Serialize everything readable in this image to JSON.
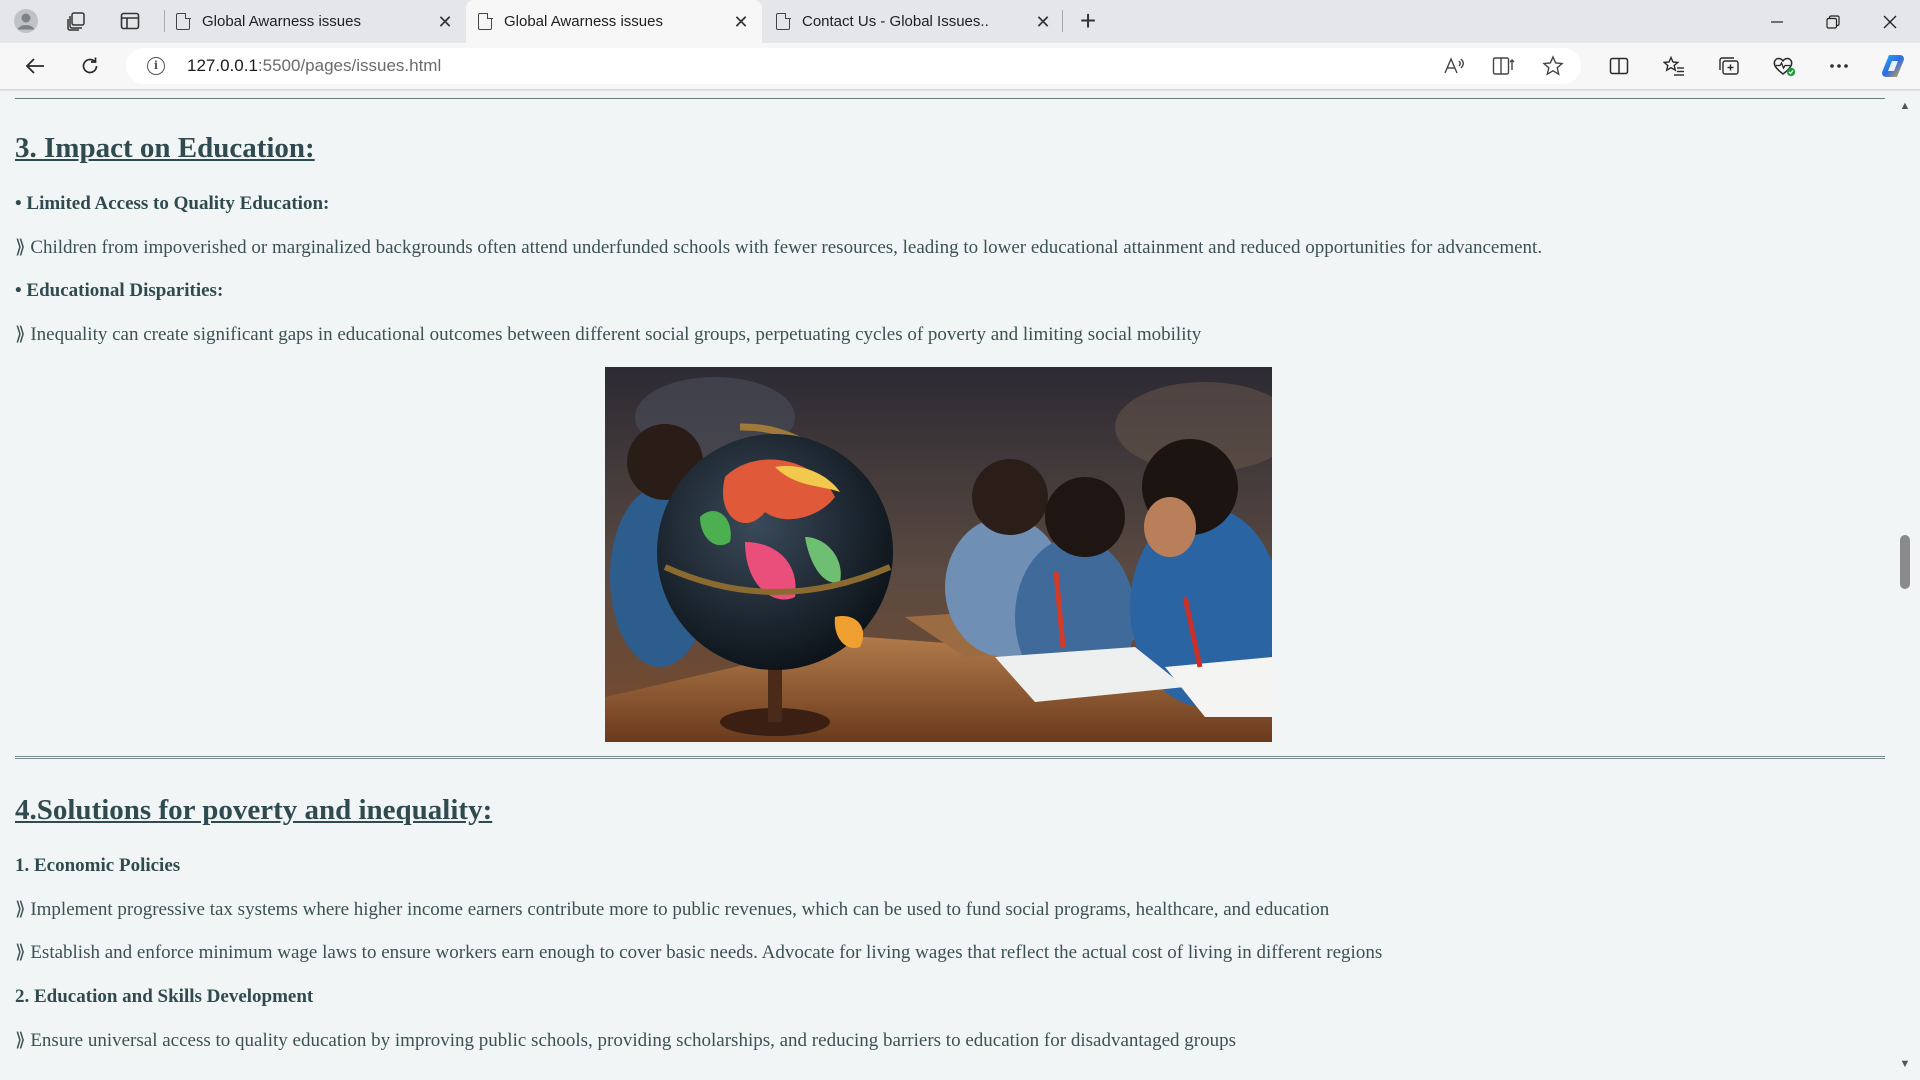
{
  "browser": {
    "tabs": [
      {
        "title": "Global Awarness issues",
        "active": false
      },
      {
        "title": "Global Awarness issues",
        "active": true
      },
      {
        "title": "Contact Us - Global Issues..",
        "active": false
      }
    ],
    "new_tab_symbol": "+",
    "close_symbol": "✕",
    "url_host": "127.0.0.1",
    "url_rest": ":5500/pages/issues.html",
    "info_symbol": "i"
  },
  "page": {
    "section3": {
      "heading": "3. Impact on Education:",
      "points": [
        {
          "title": "• Limited Access to Quality Education:",
          "text": "⟫ Children from impoverished or marginalized backgrounds often attend underfunded schools with fewer resources, leading to lower educational attainment and reduced opportunities for advancement."
        },
        {
          "title": "• Educational Disparities:",
          "text": "⟫ Inequality can create significant gaps in educational outcomes between different social groups, perpetuating cycles of poverty and limiting social mobility"
        }
      ]
    },
    "section4": {
      "heading": "4.Solutions for poverty and inequality:",
      "sub1": "1. Economic Policies",
      "sub1_items": [
        "⟫ Implement progressive tax systems where higher income earners contribute more to public revenues, which can be used to fund social programs, healthcare, and education",
        "⟫ Establish and enforce minimum wage laws to ensure workers earn enough to cover basic needs. Advocate for living wages that reflect the actual cost of living in different regions"
      ],
      "sub2": "2. Education and Skills Development",
      "sub2_items": [
        "⟫ Ensure universal access to quality education by improving public schools, providing scholarships, and reducing barriers to education for disadvantaged groups"
      ]
    }
  },
  "colors": {
    "page_background": "#f2f5f5",
    "heading_text": "#2f4b4f",
    "body_text": "#3b5154"
  }
}
